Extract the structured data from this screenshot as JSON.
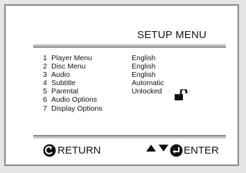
{
  "screen": {
    "title": "SETUP MENU",
    "menu_items": [
      {
        "number": "1",
        "label": "Player Menu",
        "value": "English"
      },
      {
        "number": "2",
        "label": "Disc Menu",
        "value": "English"
      },
      {
        "number": "3",
        "label": "Audio",
        "value": "English"
      },
      {
        "number": "4",
        "label": "Subtitle",
        "value": "Automatic"
      },
      {
        "number": "5",
        "label": "Parental",
        "value": "Unlocked"
      },
      {
        "number": "6",
        "label": "Audio Options",
        "value": ""
      },
      {
        "number": "7",
        "label": "Display Options",
        "value": ""
      }
    ],
    "footer": {
      "return_label": "RETURN",
      "enter_label": "ENTER"
    }
  },
  "icons": {
    "return": "return-icon",
    "up": "triangle-up-icon",
    "down": "triangle-down-icon",
    "enter": "enter-icon",
    "lock": "open-lock-icon"
  },
  "colors": {
    "frame_border": "#8f8f8f",
    "panel_bg": "#ffffff",
    "bar_light": "#c4c4c4",
    "bar_dark": "#8a8a8a",
    "text": "#111111"
  }
}
